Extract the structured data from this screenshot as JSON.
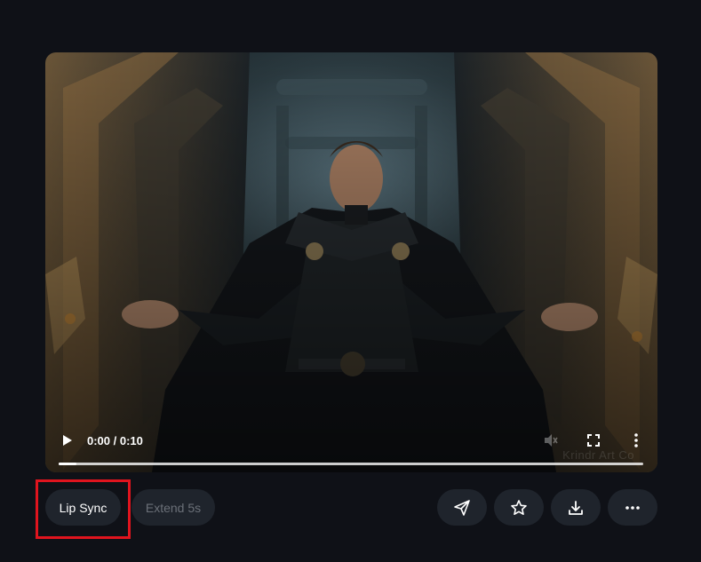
{
  "player": {
    "time_display": "0:00 / 0:10",
    "progress": 0.03,
    "watermark": "Krindr Art Co"
  },
  "actions": {
    "lip_sync_label": "Lip Sync",
    "extend_label": "Extend 5s"
  },
  "icons": {
    "play": "play-icon",
    "volume": "volume-muted-icon",
    "fullscreen": "fullscreen-icon",
    "menu": "more-vertical-icon",
    "send": "send-icon",
    "star": "star-icon",
    "download": "download-icon",
    "more": "more-horizontal-icon"
  },
  "colors": {
    "page_bg": "#0f1117",
    "button_bg": "#1f242c",
    "highlight": "#e0141e",
    "disabled_text": "#6b7078"
  }
}
